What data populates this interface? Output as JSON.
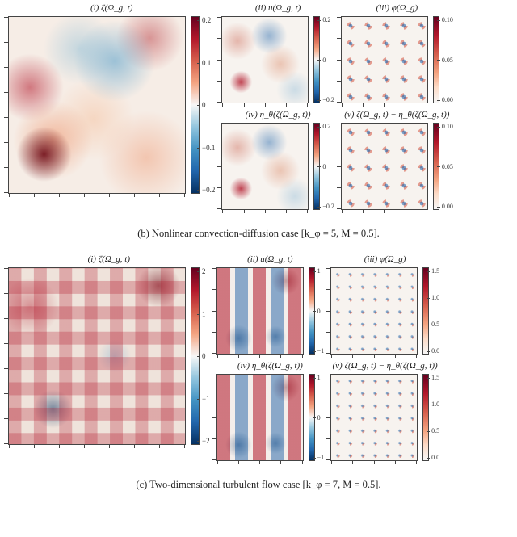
{
  "colormap": "RdBu_r",
  "figures": {
    "b": {
      "caption": "(b) Nonlinear convection-diffusion case [k_φ = 5, M = 0.5].",
      "panels": {
        "main": {
          "title": "(i) ζ(Ω_g, t)"
        },
        "small1": {
          "title": "(ii) u(Ω_g, t)"
        },
        "small2": {
          "title": "(iii) φ(Ω_g)"
        },
        "small3": {
          "title": "(iv) η_θ(ζ(Ω_g, t))"
        },
        "small4": {
          "title": "(v) ζ(Ω_g, t) − η_θ(ζ(Ω_g, t))"
        }
      },
      "colorbars": {
        "main": {
          "ticks": [
            "0.2",
            "0.1",
            "0",
            "−0.1",
            "−0.2"
          ]
        },
        "small_u": {
          "ticks": [
            "0.2",
            "0",
            "−0.2"
          ]
        },
        "small_phi": {
          "ticks": [
            "0.10",
            "0.05",
            "0.00"
          ]
        }
      }
    },
    "c": {
      "caption": "(c) Two-dimensional turbulent flow case [k_φ = 7, M = 0.5].",
      "panels": {
        "main": {
          "title": "(i) ζ(Ω_g, t)"
        },
        "small1": {
          "title": "(ii) u(Ω_g, t)"
        },
        "small2": {
          "title": "(iii) φ(Ω_g)"
        },
        "small3": {
          "title": "(iv) η_θ(ζ(Ω_g, t))"
        },
        "small4": {
          "title": "(v) ζ(Ω_g, t) − η_θ(ζ(Ω_g, t))"
        }
      },
      "colorbars": {
        "main": {
          "ticks": [
            "2",
            "1",
            "0",
            "−1",
            "−2"
          ]
        },
        "small_u": {
          "ticks": [
            "1",
            "0",
            "−1"
          ]
        },
        "small_phi": {
          "ticks": [
            "1.5",
            "1.0",
            "0.5",
            "0.0"
          ]
        }
      }
    }
  },
  "chart_data": [
    {
      "id": "b",
      "type": "heatmap",
      "title": "Nonlinear convection-diffusion case",
      "params": {
        "k_phi": 5,
        "M": 0.5
      },
      "subplots": [
        {
          "id": "i",
          "label": "ζ(Ω_g, t)",
          "field": "composite",
          "value_range": [
            -0.28,
            0.28
          ],
          "colormap": "RdBu_r"
        },
        {
          "id": "ii",
          "label": "u(Ω_g, t)",
          "field": "velocity",
          "value_range": [
            -0.25,
            0.25
          ],
          "colormap": "RdBu_r"
        },
        {
          "id": "iii",
          "label": "φ(Ω_g)",
          "field": "forcing",
          "value_range": [
            0.0,
            0.1
          ],
          "colormap": "RdBu_r",
          "pattern": "periodic_k5"
        },
        {
          "id": "iv",
          "label": "η_θ(ζ(Ω_g, t))",
          "field": "network_output",
          "value_range": [
            -0.25,
            0.25
          ],
          "colormap": "RdBu_r"
        },
        {
          "id": "v",
          "label": "ζ(Ω_g, t) − η_θ(ζ(Ω_g, t))",
          "field": "residual",
          "value_range": [
            0.0,
            0.1
          ],
          "colormap": "RdBu_r",
          "pattern": "periodic_k5"
        }
      ]
    },
    {
      "id": "c",
      "type": "heatmap",
      "title": "Two-dimensional turbulent flow case",
      "params": {
        "k_phi": 7,
        "M": 0.5
      },
      "subplots": [
        {
          "id": "i",
          "label": "ζ(Ω_g, t)",
          "field": "composite",
          "value_range": [
            -2.5,
            2.5
          ],
          "colormap": "RdBu_r"
        },
        {
          "id": "ii",
          "label": "u(Ω_g, t)",
          "field": "velocity",
          "value_range": [
            -1.4,
            1.4
          ],
          "colormap": "RdBu_r"
        },
        {
          "id": "iii",
          "label": "φ(Ω_g)",
          "field": "forcing",
          "value_range": [
            0.0,
            1.6
          ],
          "colormap": "RdBu_r",
          "pattern": "periodic_k7"
        },
        {
          "id": "iv",
          "label": "η_θ(ζ(Ω_g, t))",
          "field": "network_output",
          "value_range": [
            -1.4,
            1.4
          ],
          "colormap": "RdBu_r"
        },
        {
          "id": "v",
          "label": "ζ(Ω_g, t) − η_θ(ζ(Ω_g, t))",
          "field": "residual",
          "value_range": [
            0.0,
            1.6
          ],
          "colormap": "RdBu_r",
          "pattern": "periodic_k7"
        }
      ]
    }
  ]
}
